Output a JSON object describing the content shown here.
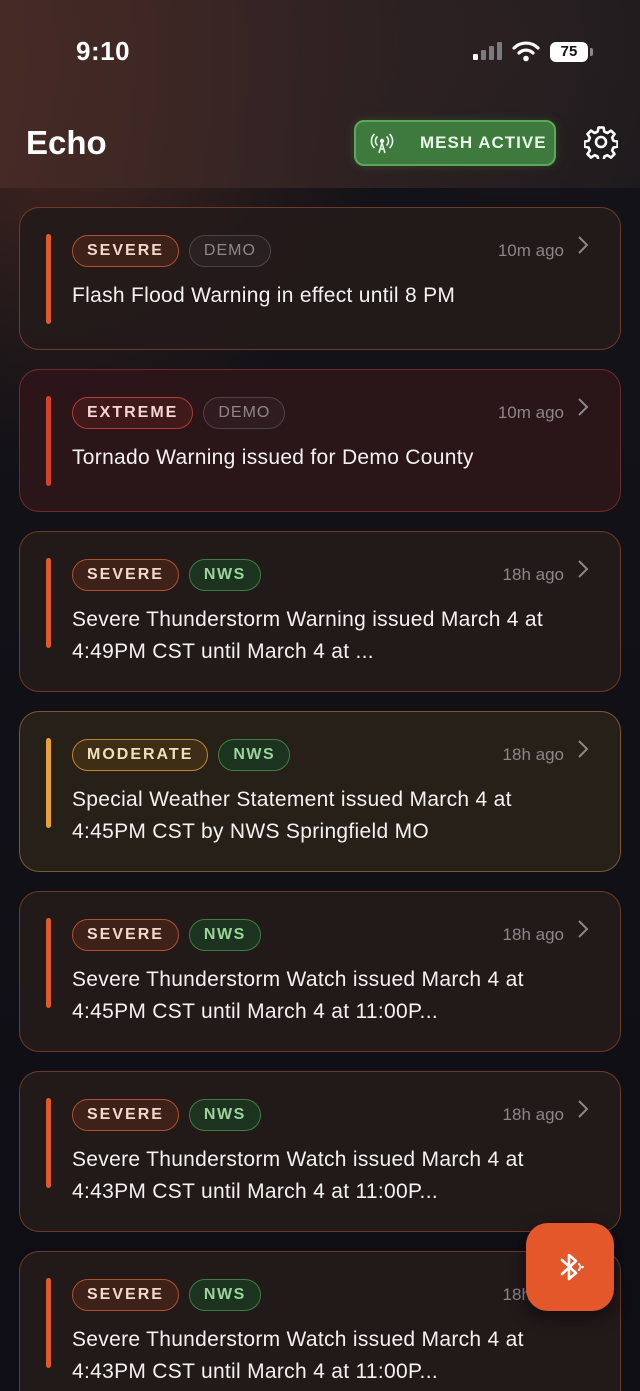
{
  "status_bar": {
    "time": "9:10",
    "battery": "75"
  },
  "header": {
    "title": "Echo",
    "mesh_label": "MESH ACTIVE"
  },
  "alerts": [
    {
      "severity": "SEVERE",
      "source": "DEMO",
      "time": "10m ago",
      "title": "Flash Flood Warning in effect until 8 PM"
    },
    {
      "severity": "EXTREME",
      "source": "DEMO",
      "time": "10m ago",
      "title": "Tornado Warning issued for Demo County"
    },
    {
      "severity": "SEVERE",
      "source": "NWS",
      "time": "18h ago",
      "title": "Severe Thunderstorm Warning issued March 4 at 4:49PM CST until March 4 at ..."
    },
    {
      "severity": "MODERATE",
      "source": "NWS",
      "time": "18h ago",
      "title": "Special Weather Statement issued March 4 at 4:45PM CST by NWS Springfield MO"
    },
    {
      "severity": "SEVERE",
      "source": "NWS",
      "time": "18h ago",
      "title": "Severe Thunderstorm Watch issued March 4 at 4:45PM CST until March 4 at 11:00P..."
    },
    {
      "severity": "SEVERE",
      "source": "NWS",
      "time": "18h ago",
      "title": "Severe Thunderstorm Watch issued March 4 at 4:43PM CST until March 4 at 11:00P..."
    },
    {
      "severity": "SEVERE",
      "source": "NWS",
      "time": "18h ago",
      "title": "Severe Thunderstorm Watch issued March 4 at 4:43PM CST until March 4 at 11:00P..."
    }
  ],
  "colors": {
    "severe": "#e05a2a",
    "extreme": "#d8402a",
    "moderate": "#e8a13a",
    "mesh": "#3e7a3e",
    "fab": "#e4572a"
  },
  "icons": {
    "settings": "gear-icon",
    "mesh": "antenna-icon",
    "fab": "bluetooth-icon",
    "row": "chevron-right-icon"
  }
}
